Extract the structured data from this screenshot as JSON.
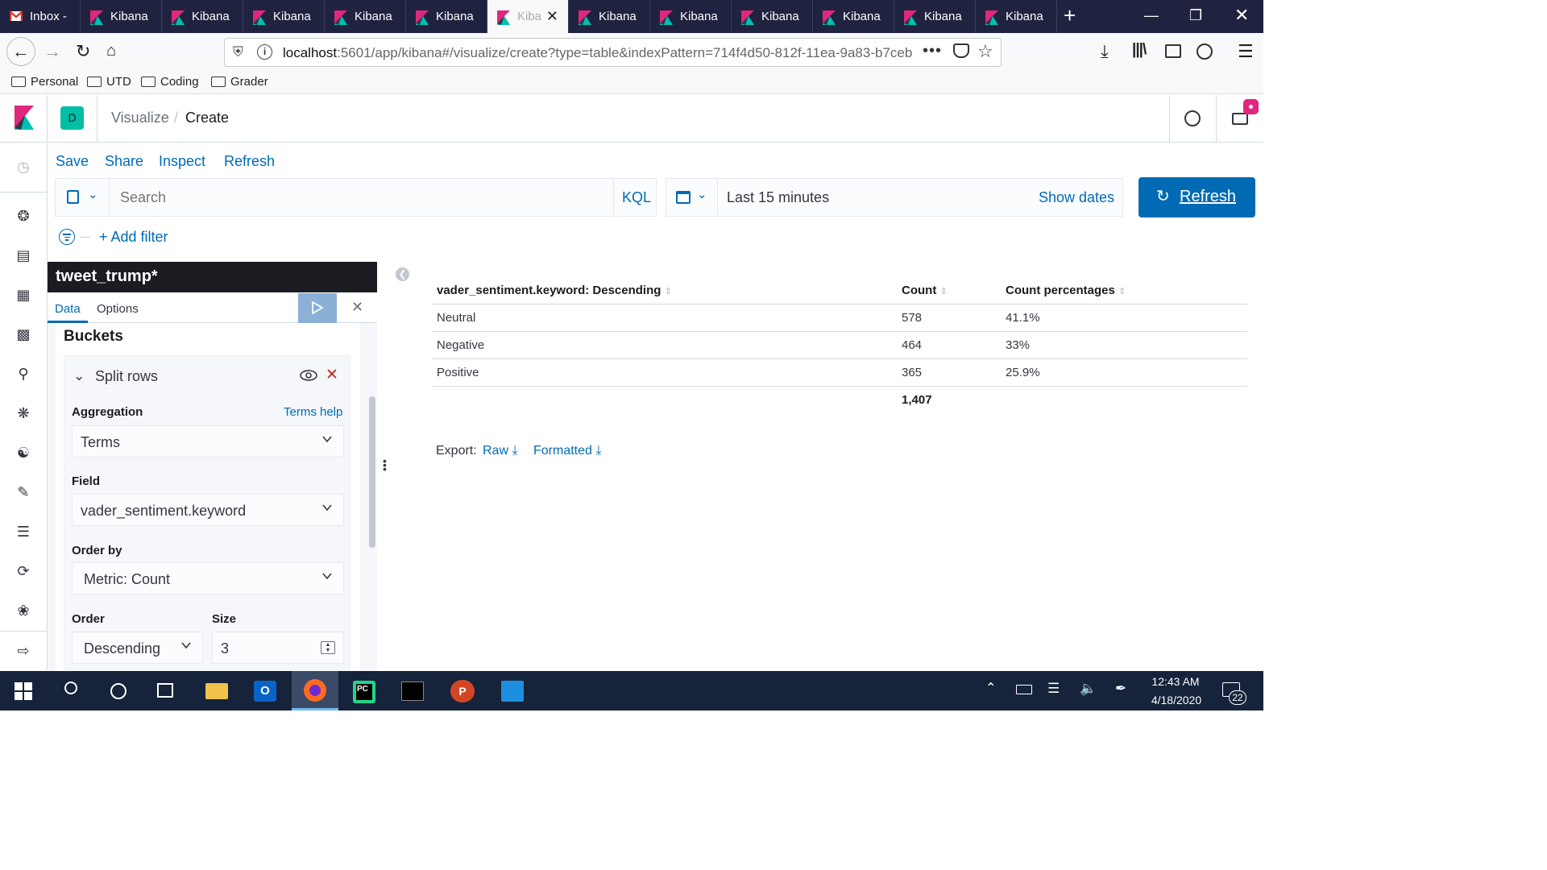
{
  "browser": {
    "tabs": [
      {
        "label": "Inbox -",
        "icon": "gmail-icon"
      },
      {
        "label": "Kibana",
        "icon": "kibana-icon"
      },
      {
        "label": "Kibana",
        "icon": "kibana-icon"
      },
      {
        "label": "Kibana",
        "icon": "kibana-icon"
      },
      {
        "label": "Kibana",
        "icon": "kibana-icon"
      },
      {
        "label": "Kibana",
        "icon": "kibana-icon"
      },
      {
        "label": "Kiba",
        "icon": "kibana-icon",
        "active": true
      },
      {
        "label": "Kibana",
        "icon": "kibana-icon"
      },
      {
        "label": "Kibana",
        "icon": "kibana-icon"
      },
      {
        "label": "Kibana",
        "icon": "kibana-icon"
      },
      {
        "label": "Kibana",
        "icon": "kibana-icon"
      },
      {
        "label": "Kibana",
        "icon": "kibana-icon"
      },
      {
        "label": "Kibana",
        "icon": "kibana-icon"
      }
    ],
    "url_host": "localhost",
    "url_rest": ":5601/app/kibana#/visualize/create?type=table&indexPattern=714f4d50-812f-11ea-9a83-b7ceb",
    "bookmarks": [
      "Personal",
      "UTD",
      "Coding",
      "Grader"
    ]
  },
  "kibana": {
    "space_initial": "D",
    "breadcrumb": [
      "Visualize",
      "Create"
    ],
    "top_menu": [
      "Save",
      "Share",
      "Inspect",
      "Refresh"
    ],
    "search_placeholder": "Search",
    "query_language": "KQL",
    "time_range": "Last 15 minutes",
    "show_dates": "Show dates",
    "refresh_button": "Refresh",
    "add_filter": "+ Add filter",
    "colors": {
      "accent": "#006bb4",
      "dark": "#1a1c21",
      "pink": "#e0267d"
    }
  },
  "editor": {
    "index_title": "tweet_trump*",
    "tabs": [
      "Data",
      "Options"
    ],
    "buckets_heading": "Buckets",
    "split_label": "Split rows",
    "aggregation_label": "Aggregation",
    "terms_help": "Terms help",
    "aggregation_value": "Terms",
    "field_label": "Field",
    "field_value": "vader_sentiment.keyword",
    "order_by_label": "Order by",
    "order_by_value": "Metric: Count",
    "order_label": "Order",
    "order_value": "Descending",
    "size_label": "Size",
    "size_value": "3"
  },
  "table": {
    "columns": [
      "vader_sentiment.keyword: Descending",
      "Count",
      "Count percentages"
    ],
    "rows": [
      [
        "Neutral",
        "578",
        "41.1%"
      ],
      [
        "Negative",
        "464",
        "33%"
      ],
      [
        "Positive",
        "365",
        "25.9%"
      ]
    ],
    "total": "1,407",
    "export_label": "Export:",
    "export_raw": "Raw",
    "export_formatted": "Formatted"
  },
  "taskbar": {
    "time": "12:43 AM",
    "date": "4/18/2020",
    "notifications": "22"
  }
}
